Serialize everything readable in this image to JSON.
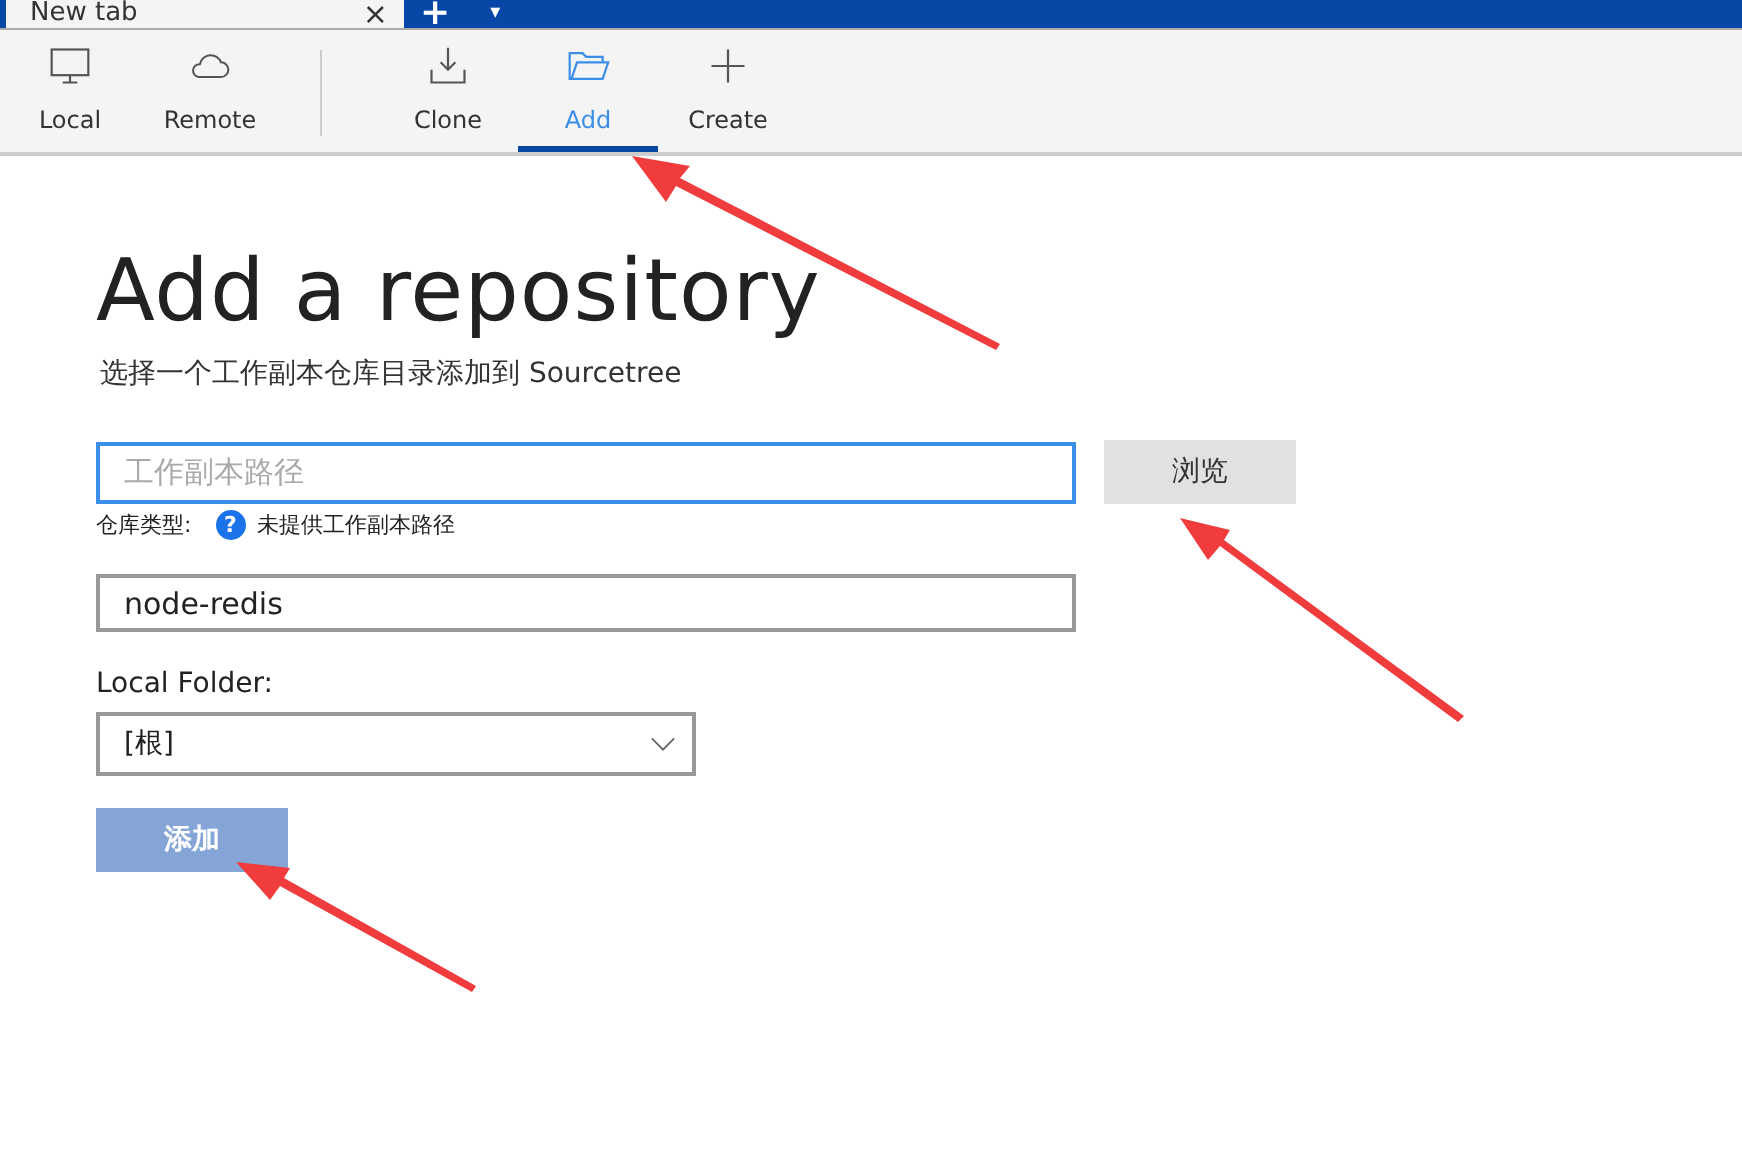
{
  "tab_strip": {
    "tabs": [
      {
        "label": "New tab",
        "close": "×",
        "selected": true
      }
    ],
    "new_tab": "+",
    "menu": "▾"
  },
  "toolbar": {
    "groups": [
      [
        {
          "label": "Local",
          "kind": "monitor",
          "selected": false
        },
        {
          "label": "Remote",
          "kind": "cloud",
          "selected": false
        }
      ],
      [
        {
          "label": "Clone",
          "kind": "download",
          "selected": false
        },
        {
          "label": "Add",
          "kind": "folder",
          "selected": true
        },
        {
          "label": "Create",
          "kind": "plus",
          "selected": false
        }
      ]
    ]
  },
  "page": {
    "title": "Add a repository",
    "subtitle": "选择一个工作副本仓库目录添加到 Sourcetree",
    "path_field": {
      "placeholder": "工作副本路径",
      "focused": true
    },
    "browse_button": "浏览",
    "repo_type": {
      "label": "仓库类型:",
      "help": "?",
      "status": "未提供工作副本路径"
    },
    "name_field": {
      "value": "node-redis"
    },
    "folder_label": "Local Folder:",
    "folder_select": {
      "value": "[根]"
    },
    "add_button": {
      "label": "添加",
      "disabled": true
    }
  }
}
